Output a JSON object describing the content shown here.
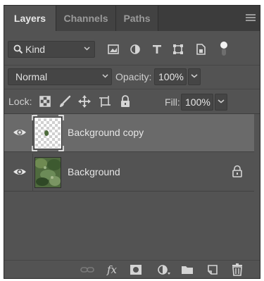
{
  "tabs": [
    {
      "label": "Layers",
      "active": true
    },
    {
      "label": "Channels",
      "active": false
    },
    {
      "label": "Paths",
      "active": false
    }
  ],
  "filter": {
    "kind_label": "Kind",
    "icons": [
      "image-filter-icon",
      "adjustment-filter-icon",
      "type-filter-icon",
      "shape-filter-icon",
      "smart-object-filter-icon",
      "filter-toggle-icon"
    ]
  },
  "blend": {
    "mode": "Normal",
    "opacity_label": "Opacity:",
    "opacity_value": "100%"
  },
  "lock": {
    "label": "Lock:",
    "fill_label": "Fill:",
    "fill_value": "100%"
  },
  "layers": [
    {
      "name": "Background copy",
      "selected": true,
      "visible": true,
      "locked": false
    },
    {
      "name": "Background",
      "selected": false,
      "visible": true,
      "locked": true
    }
  ],
  "bottom_bar": {
    "fx_label": "fx"
  },
  "colors": {
    "panel_bg": "#535353",
    "tabbar_bg": "#3c3c3c",
    "selected_layer": "#6a6a6a",
    "field_bg": "#454545"
  }
}
